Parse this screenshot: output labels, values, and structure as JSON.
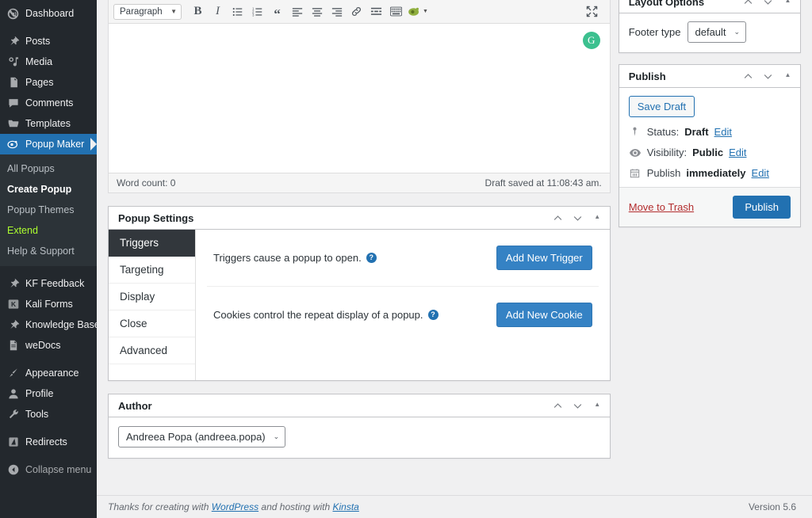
{
  "sidebar": {
    "items": [
      {
        "label": "Dashboard",
        "icon": "dashboard-icon",
        "current": false,
        "gap": false
      },
      {
        "label": "Posts",
        "icon": "pin-icon",
        "current": false,
        "gap": true
      },
      {
        "label": "Media",
        "icon": "media-icon",
        "current": false,
        "gap": false
      },
      {
        "label": "Pages",
        "icon": "pages-icon",
        "current": false,
        "gap": false
      },
      {
        "label": "Comments",
        "icon": "comments-icon",
        "current": false,
        "gap": false
      },
      {
        "label": "Templates",
        "icon": "folder-icon",
        "current": false,
        "gap": false
      },
      {
        "label": "Popup Maker",
        "icon": "popup-maker-icon",
        "current": true,
        "gap": false
      }
    ],
    "submenu": {
      "items": [
        {
          "label": "All Popups",
          "state": "normal"
        },
        {
          "label": "Create Popup",
          "state": "current"
        },
        {
          "label": "Popup Themes",
          "state": "normal"
        },
        {
          "label": "Extend",
          "state": "accent"
        },
        {
          "label": "Help & Support",
          "state": "normal"
        }
      ]
    },
    "items2": [
      {
        "label": "KF Feedback",
        "icon": "pin-icon",
        "gap": true
      },
      {
        "label": "Kali Forms",
        "icon": "kali-forms-icon",
        "gap": false
      },
      {
        "label": "Knowledge Base",
        "icon": "pin-icon",
        "gap": false
      },
      {
        "label": "weDocs",
        "icon": "document-icon",
        "gap": false
      },
      {
        "label": "Appearance",
        "icon": "brush-icon",
        "gap": true
      },
      {
        "label": "Profile",
        "icon": "user-icon",
        "gap": false
      },
      {
        "label": "Tools",
        "icon": "wrench-icon",
        "gap": false
      },
      {
        "label": "Redirects",
        "icon": "redirects-icon",
        "gap": true
      }
    ],
    "collapse": {
      "label": "Collapse menu",
      "icon": "collapse-icon"
    },
    "accent_color": "#2271b1",
    "extend_color": "#adff2f"
  },
  "editor": {
    "format_select": {
      "value": "Paragraph"
    },
    "toolbar_buttons": [
      {
        "name": "bold-button",
        "label": "B"
      },
      {
        "name": "italic-button",
        "label": "I"
      },
      {
        "name": "bulleted-list-button",
        "label": ""
      },
      {
        "name": "numbered-list-button",
        "label": ""
      },
      {
        "name": "blockquote-button",
        "label": "“"
      },
      {
        "name": "align-left-button",
        "label": ""
      },
      {
        "name": "align-center-button",
        "label": ""
      },
      {
        "name": "align-right-button",
        "label": ""
      },
      {
        "name": "insert-link-button",
        "label": ""
      },
      {
        "name": "read-more-button",
        "label": ""
      },
      {
        "name": "toolbar-toggle-button",
        "label": ""
      },
      {
        "name": "popup-maker-shortcode-button",
        "label": ""
      }
    ],
    "fullscreen_label": "Fullscreen",
    "grammarly_icon_letter": "G",
    "status": {
      "word_count": "Word count: 0",
      "draft_saved": "Draft saved at 11:08:43 am."
    }
  },
  "popup_settings": {
    "title": "Popup Settings",
    "tabs": [
      {
        "label": "Triggers",
        "active": true
      },
      {
        "label": "Targeting",
        "active": false
      },
      {
        "label": "Display",
        "active": false
      },
      {
        "label": "Close",
        "active": false
      },
      {
        "label": "Advanced",
        "active": false
      }
    ],
    "rows": [
      {
        "description": "Triggers cause a popup to open.",
        "help_icon": "?",
        "button_label": "Add New Trigger",
        "button_name": "add-new-trigger-button"
      },
      {
        "description": "Cookies control the repeat display of a popup.",
        "help_icon": "?",
        "button_label": "Add New Cookie",
        "button_name": "add-new-cookie-button"
      }
    ]
  },
  "author_box": {
    "title": "Author",
    "selected": "Andreea Popa (andreea.popa)"
  },
  "layout_options": {
    "title": "Layout Options",
    "field_label": "Footer type",
    "field_value": "default"
  },
  "publish_box": {
    "title": "Publish",
    "save_draft_label": "Save Draft",
    "status_label": "Status:",
    "status_value": "Draft",
    "status_edit": "Edit",
    "visibility_label": "Visibility:",
    "visibility_value": "Public",
    "visibility_edit": "Edit",
    "schedule_label": "Publish",
    "schedule_value": "immediately",
    "schedule_edit": "Edit",
    "trash_label": "Move to Trash",
    "publish_label": "Publish",
    "publish_color": "#2271b1",
    "trash_color": "#b32d2e"
  },
  "footer": {
    "thanks_prefix": "Thanks for creating with ",
    "wordpress_link": "WordPress",
    "thanks_middle": " and hosting with ",
    "host_link": "Kinsta",
    "version": "Version 5.6"
  }
}
